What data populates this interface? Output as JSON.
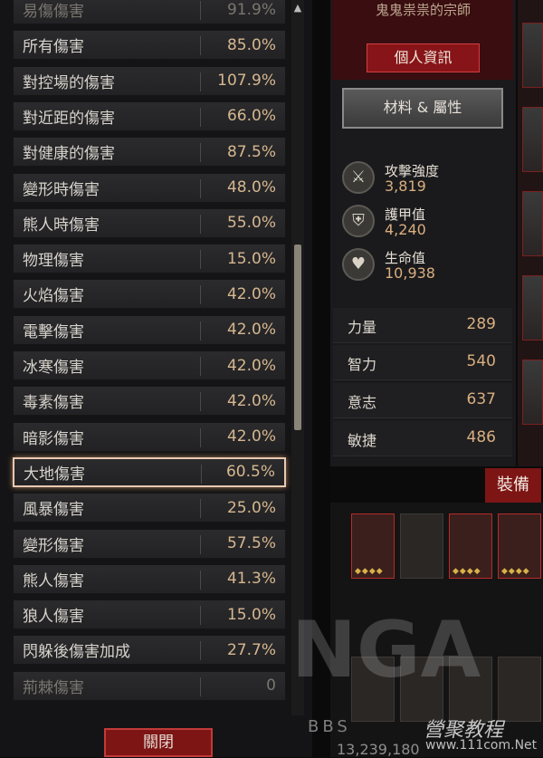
{
  "stats_list": [
    {
      "name": "易傷傷害",
      "value": "91.9%"
    },
    {
      "name": "所有傷害",
      "value": "85.0%"
    },
    {
      "name": "對控場的傷害",
      "value": "107.9%"
    },
    {
      "name": "對近距的傷害",
      "value": "66.0%"
    },
    {
      "name": "對健康的傷害",
      "value": "87.5%"
    },
    {
      "name": "變形時傷害",
      "value": "48.0%"
    },
    {
      "name": "熊人時傷害",
      "value": "55.0%"
    },
    {
      "name": "物理傷害",
      "value": "15.0%"
    },
    {
      "name": "火焰傷害",
      "value": "42.0%"
    },
    {
      "name": "電擊傷害",
      "value": "42.0%"
    },
    {
      "name": "冰寒傷害",
      "value": "42.0%"
    },
    {
      "name": "毒素傷害",
      "value": "42.0%"
    },
    {
      "name": "暗影傷害",
      "value": "42.0%"
    },
    {
      "name": "大地傷害",
      "value": "60.5%"
    },
    {
      "name": "風暴傷害",
      "value": "25.0%"
    },
    {
      "name": "變形傷害",
      "value": "57.5%"
    },
    {
      "name": "熊人傷害",
      "value": "41.3%"
    },
    {
      "name": "狼人傷害",
      "value": "15.0%"
    },
    {
      "name": "閃躲後傷害加成",
      "value": "27.7%"
    },
    {
      "name": "荊棘傷害",
      "value": "0"
    }
  ],
  "selected_stat": "大地傷害",
  "close_button": "關閉",
  "character": {
    "title": "鬼鬼祟祟的宗師",
    "profile_button": "個人資訊",
    "materials_button": "材料 & 屬性",
    "core_stats": [
      {
        "label": "攻擊強度",
        "value": "3,819",
        "icon": "crossed-swords-icon"
      },
      {
        "label": "護甲值",
        "value": "4,240",
        "icon": "shield-icon"
      },
      {
        "label": "生命值",
        "value": "10,938",
        "icon": "heart-icon"
      }
    ],
    "attributes": [
      {
        "label": "力量",
        "value": "289"
      },
      {
        "label": "智力",
        "value": "540"
      },
      {
        "label": "意志",
        "value": "637"
      },
      {
        "label": "敏捷",
        "value": "486"
      }
    ]
  },
  "equipment_label": "裝備",
  "gold": "13,239,180",
  "watermark": {
    "logo": "NGA",
    "bbs": "BBS",
    "text": "營聚教程",
    "url": "www.111com.Net"
  },
  "colors": {
    "accent_red": "#871418",
    "value_gold": "#d9ae80",
    "selected_border": "#e9c9b0"
  }
}
